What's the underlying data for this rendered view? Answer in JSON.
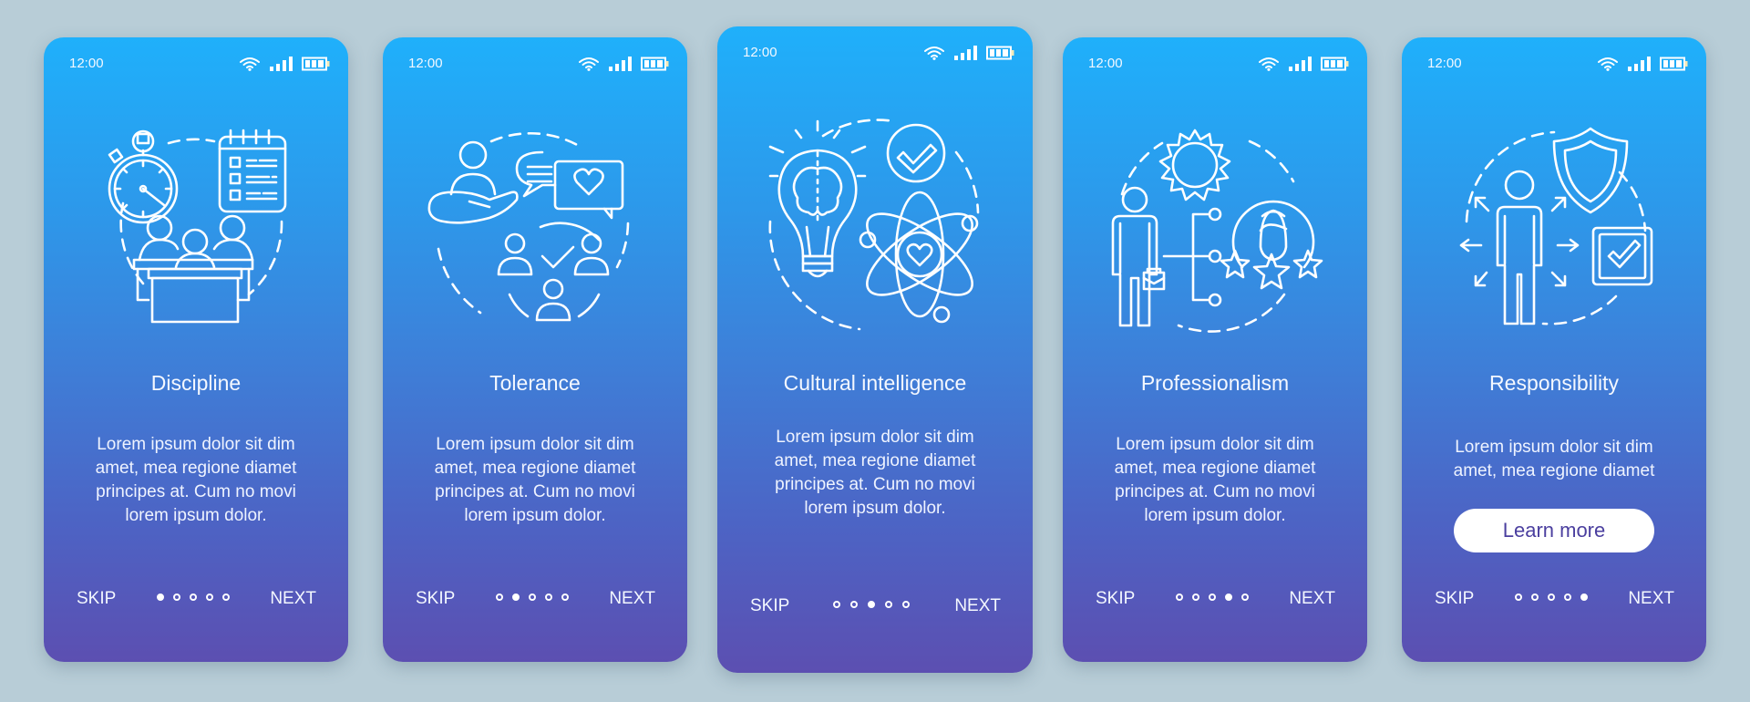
{
  "status_bar": {
    "time": "12:00",
    "icons": [
      "wifi-icon",
      "signal-icon",
      "battery-icon"
    ]
  },
  "colors": {
    "background": "#b8cdd7",
    "gradient_top": "#1fb0fb",
    "gradient_bottom": "#5c4fb1",
    "text": "#ffffff",
    "button_text": "#4b3f9f"
  },
  "footer": {
    "skip_label": "SKIP",
    "next_label": "NEXT",
    "page_count": 5
  },
  "screens": [
    {
      "title": "Discipline",
      "body": [
        "Lorem ipsum dolor sit dim",
        "amet, mea regione diamet",
        "principes at. Cum no movi",
        "lorem ipsum dolor."
      ],
      "illustration": "discipline-icon",
      "active_page": 1
    },
    {
      "title": "Tolerance",
      "body": [
        "Lorem ipsum dolor sit dim",
        "amet, mea regione diamet",
        "principes at. Cum no movi",
        "lorem ipsum dolor."
      ],
      "illustration": "tolerance-icon",
      "active_page": 2
    },
    {
      "title": "Cultural intelligence",
      "body": [
        "Lorem ipsum dolor sit dim",
        "amet, mea regione diamet",
        "principes at. Cum no movi",
        "lorem ipsum dolor."
      ],
      "illustration": "cultural-intelligence-icon",
      "active_page": 3
    },
    {
      "title": "Professionalism",
      "body": [
        "Lorem ipsum dolor sit dim",
        "amet, mea regione diamet",
        "principes at. Cum no movi",
        "lorem ipsum dolor."
      ],
      "illustration": "professionalism-icon",
      "active_page": 4
    },
    {
      "title": "Responsibility",
      "body": [
        "Lorem ipsum dolor sit dim",
        "amet, mea regione diamet"
      ],
      "illustration": "responsibility-icon",
      "button_label": "Learn more",
      "active_page": 5
    }
  ]
}
